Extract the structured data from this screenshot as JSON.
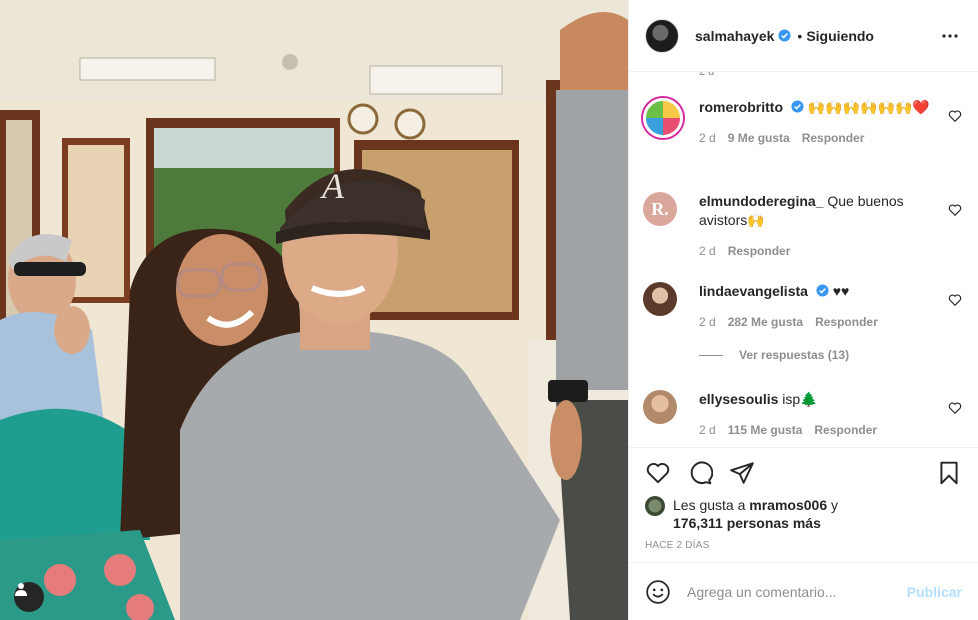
{
  "header": {
    "username": "salmahayek",
    "separator": "•",
    "follow_status": "Siguiendo"
  },
  "comments_scroll_fragment": "2 d",
  "comments": [
    {
      "username": "romerobritto",
      "verified": true,
      "text": "🙌🙌🙌🙌🙌🙌❤️",
      "age": "2 d",
      "likes": "9 Me gusta",
      "reply": "Responder"
    },
    {
      "username": "elmundoderegina_",
      "verified": false,
      "text": "Que buenos avistors🙌",
      "age": "2 d",
      "likes": "",
      "reply": "Responder"
    },
    {
      "username": "lindaevangelista",
      "verified": true,
      "text": "♥♥",
      "age": "2 d",
      "likes": "282 Me gusta",
      "reply": "Responder"
    },
    {
      "username": "ellysesoulis",
      "verified": false,
      "text": "isp🌲",
      "age": "2 d",
      "likes": "115 Me gusta",
      "reply": "Responder"
    }
  ],
  "view_replies": "Ver respuestas (13)",
  "likes_summary": {
    "prefix": "Les gusta a",
    "user": "mramos006",
    "conj": "y",
    "others": "176,311 personas más"
  },
  "post_time": "HACE 2 DÍAS",
  "composer": {
    "placeholder": "Agrega un comentario...",
    "publish_label": "Publicar"
  },
  "colors": {
    "verified": "#3897f0",
    "publish_disabled": "#b2dffc",
    "heart_red": "#ed4956"
  },
  "icons": {
    "like": "heart-icon",
    "comment": "comment-bubble-icon",
    "share": "paper-plane-icon",
    "save": "bookmark-icon",
    "emoji": "smiley-icon",
    "more": "ellipsis-icon"
  }
}
